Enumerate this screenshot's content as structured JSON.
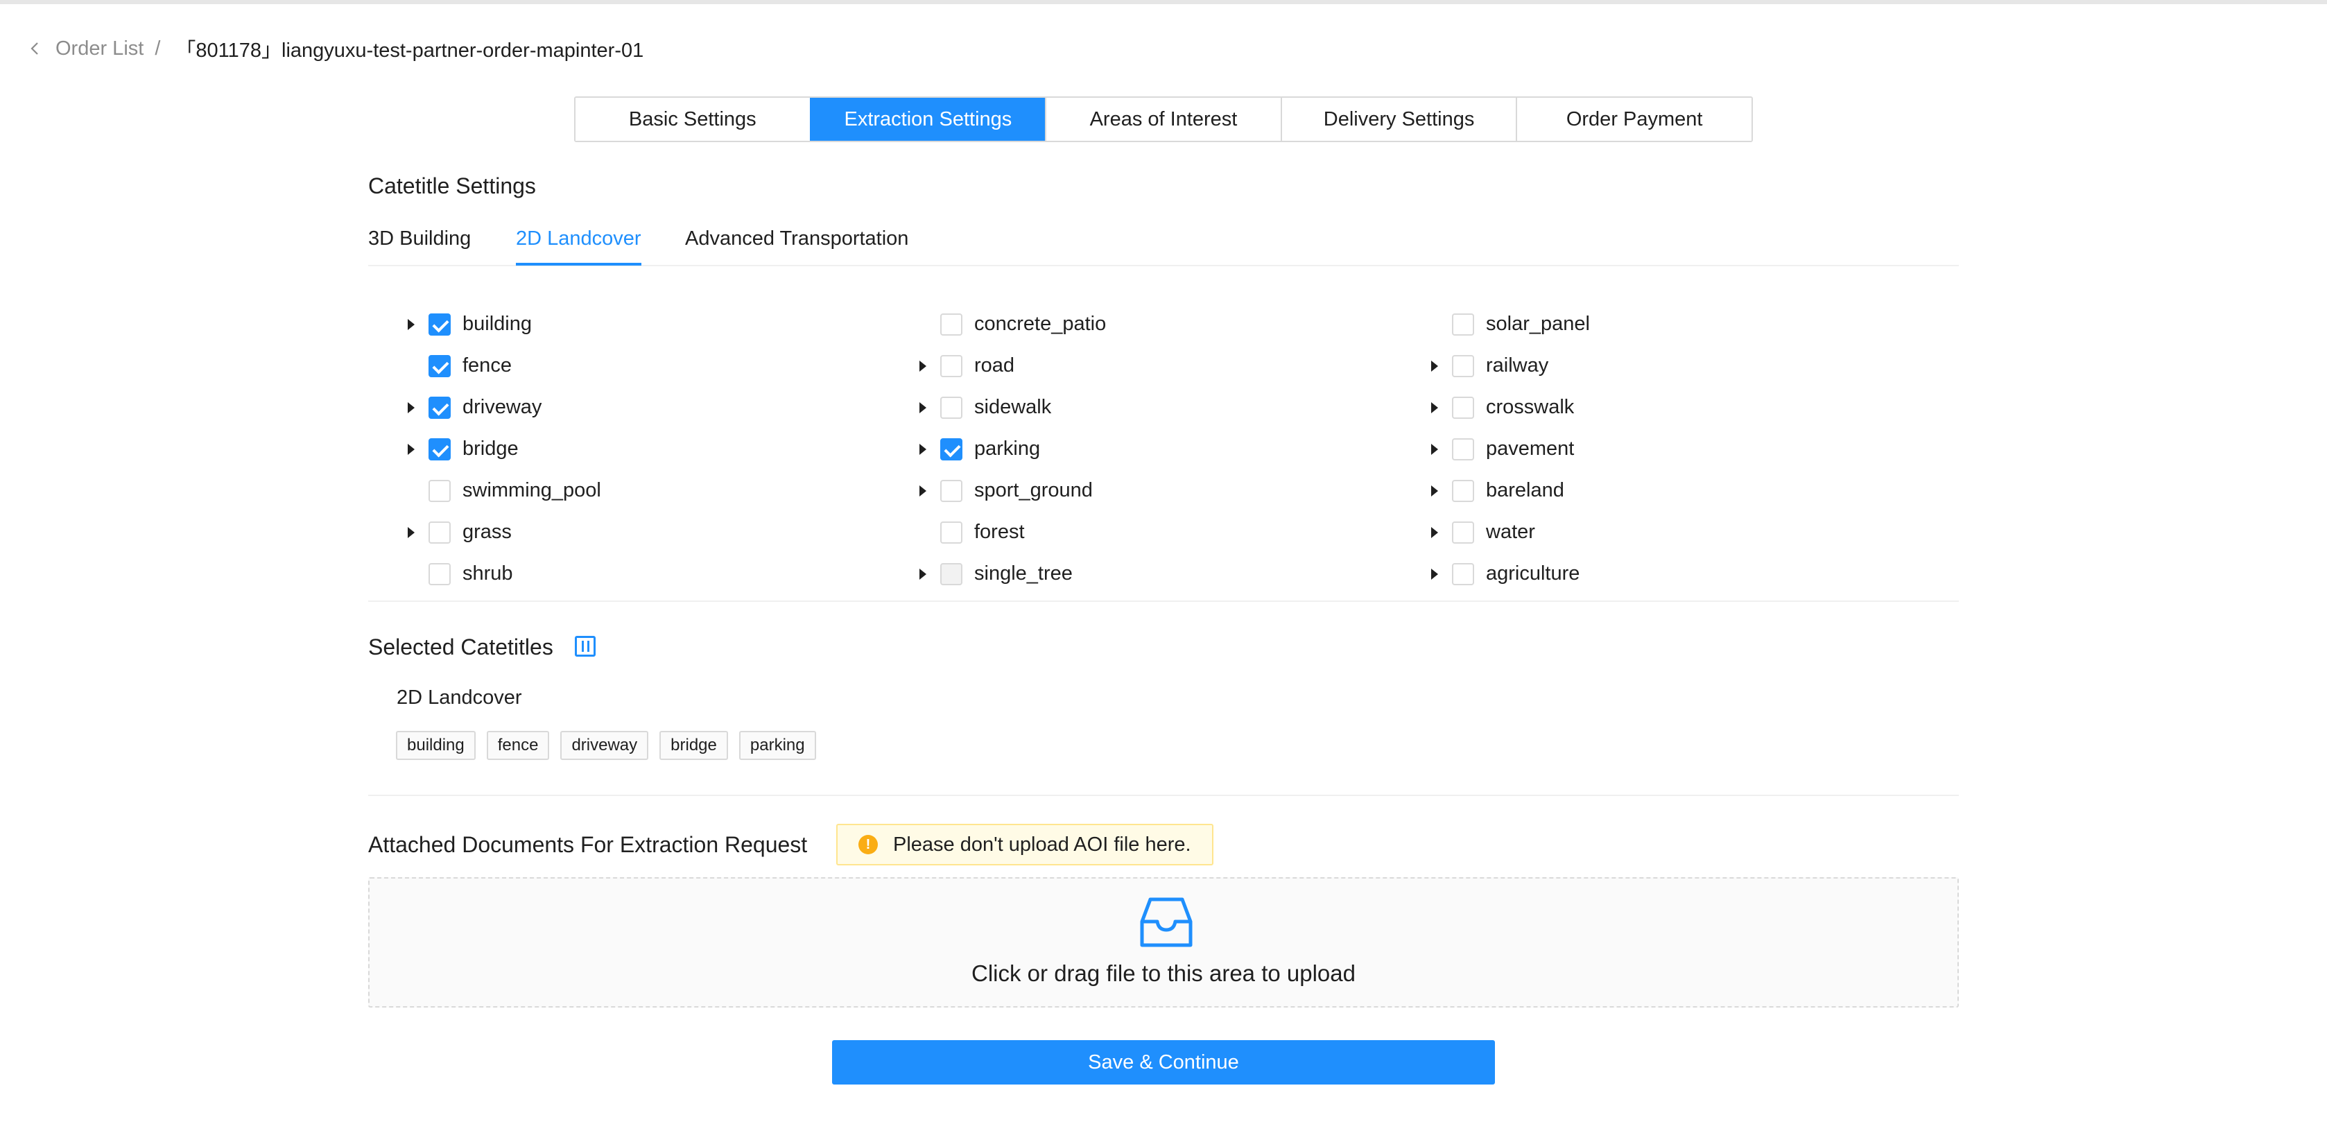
{
  "breadcrumb": {
    "back_label": "Order List",
    "separator": "/",
    "current": "「801178」liangyuxu-test-partner-order-mapinter-01"
  },
  "steps": [
    {
      "label": "Basic Settings",
      "active": false
    },
    {
      "label": "Extraction Settings",
      "active": true
    },
    {
      "label": "Areas of Interest",
      "active": false
    },
    {
      "label": "Delivery Settings",
      "active": false
    },
    {
      "label": "Order Payment",
      "active": false
    }
  ],
  "catetitle_settings": {
    "title": "Catetitle Settings",
    "tabs": [
      {
        "label": "3D Building",
        "active": false
      },
      {
        "label": "2D Landcover",
        "active": true
      },
      {
        "label": "Advanced Transportation",
        "active": false
      }
    ],
    "columns": [
      [
        {
          "label": "building",
          "checked": true,
          "expandable": true
        },
        {
          "label": "fence",
          "checked": true,
          "expandable": false
        },
        {
          "label": "driveway",
          "checked": true,
          "expandable": true
        },
        {
          "label": "bridge",
          "checked": true,
          "expandable": true
        },
        {
          "label": "swimming_pool",
          "checked": false,
          "expandable": false
        },
        {
          "label": "grass",
          "checked": false,
          "expandable": true
        },
        {
          "label": "shrub",
          "checked": false,
          "expandable": false
        }
      ],
      [
        {
          "label": "concrete_patio",
          "checked": false,
          "expandable": false
        },
        {
          "label": "road",
          "checked": false,
          "expandable": true
        },
        {
          "label": "sidewalk",
          "checked": false,
          "expandable": true
        },
        {
          "label": "parking",
          "checked": true,
          "expandable": true
        },
        {
          "label": "sport_ground",
          "checked": false,
          "expandable": true
        },
        {
          "label": "forest",
          "checked": false,
          "expandable": false
        },
        {
          "label": "single_tree",
          "checked": false,
          "expandable": true,
          "disabled": true
        }
      ],
      [
        {
          "label": "solar_panel",
          "checked": false,
          "expandable": false
        },
        {
          "label": "railway",
          "checked": false,
          "expandable": true
        },
        {
          "label": "crosswalk",
          "checked": false,
          "expandable": true
        },
        {
          "label": "pavement",
          "checked": false,
          "expandable": true
        },
        {
          "label": "bareland",
          "checked": false,
          "expandable": true
        },
        {
          "label": "water",
          "checked": false,
          "expandable": true
        },
        {
          "label": "agriculture",
          "checked": false,
          "expandable": true
        }
      ]
    ]
  },
  "selected": {
    "title": "Selected Catetitles",
    "group": "2D Landcover",
    "tags": [
      "building",
      "fence",
      "driveway",
      "bridge",
      "parking"
    ]
  },
  "attachments": {
    "title": "Attached Documents For Extraction Request",
    "warning": "Please don't upload AOI file here.",
    "warning_icon": "!",
    "upload_text": "Click or drag file to this area to upload",
    "upload_icon": "inbox-icon"
  },
  "actions": {
    "save_label": "Save & Continue"
  },
  "colors": {
    "primary": "#1f8ffd",
    "warning": "#faad14"
  }
}
